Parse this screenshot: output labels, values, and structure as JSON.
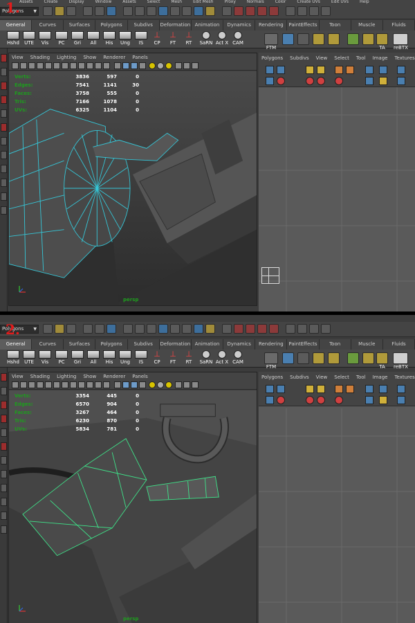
{
  "menu": [
    "Assets",
    "Create",
    "Display",
    "Window",
    "Assets",
    "Select",
    "Mesh",
    "Edit Mesh",
    "Proxy",
    "Normals",
    "Color",
    "Create UVs",
    "Edit UVs",
    "Help"
  ],
  "mode_selector": "Polygons",
  "shelf_tabs": [
    "General",
    "Curves",
    "Surfaces",
    "Polygons",
    "Subdivs",
    "Deformation",
    "Animation",
    "Dynamics",
    "Rendering",
    "PaintEffects",
    "Toon",
    "Muscle",
    "Fluids"
  ],
  "active_shelf_tab": "General",
  "shelf_buttons": [
    "Hshd",
    "UTE",
    "Vis",
    "PC",
    "Gri",
    "All",
    "His",
    "Ung",
    "IS",
    "CP",
    "FT",
    "RT",
    "SaRN",
    "Act X",
    "CAM"
  ],
  "shelf_right_labels": [
    "FTM",
    "TA",
    "reBTX"
  ],
  "viewport_menu": [
    "View",
    "Shading",
    "Lighting",
    "Show",
    "Renderer",
    "Panels"
  ],
  "uv_menu": [
    "Polygons",
    "Subdivs",
    "View",
    "Select",
    "Tool",
    "Image",
    "Textures",
    "U"
  ],
  "panels": [
    {
      "number": "1.",
      "stats": [
        {
          "label": "Verts:",
          "a": "3836",
          "b": "597",
          "c": "0"
        },
        {
          "label": "Edges:",
          "a": "7541",
          "b": "1141",
          "c": "30"
        },
        {
          "label": "Faces:",
          "a": "3758",
          "b": "555",
          "c": "0"
        },
        {
          "label": "Tris:",
          "a": "7166",
          "b": "1078",
          "c": "0"
        },
        {
          "label": "UVs:",
          "a": "6325",
          "b": "1104",
          "c": "0"
        }
      ],
      "camera": "persp"
    },
    {
      "number": "2.",
      "stats": [
        {
          "label": "Verts:",
          "a": "3354",
          "b": "445",
          "c": "0"
        },
        {
          "label": "Edges:",
          "a": "6570",
          "b": "904",
          "c": "0"
        },
        {
          "label": "Faces:",
          "a": "3267",
          "b": "464",
          "c": "0"
        },
        {
          "label": "Tris:",
          "a": "6230",
          "b": "870",
          "c": "0"
        },
        {
          "label": "UVs:",
          "a": "5834",
          "b": "781",
          "c": "0"
        }
      ],
      "camera": "persp"
    }
  ],
  "colors": {
    "wire_panel1": "#35c7d8",
    "wire_panel2": "#3ee68a",
    "stat_label": "#1e9d1e",
    "panel_number": "#e21b1b"
  }
}
